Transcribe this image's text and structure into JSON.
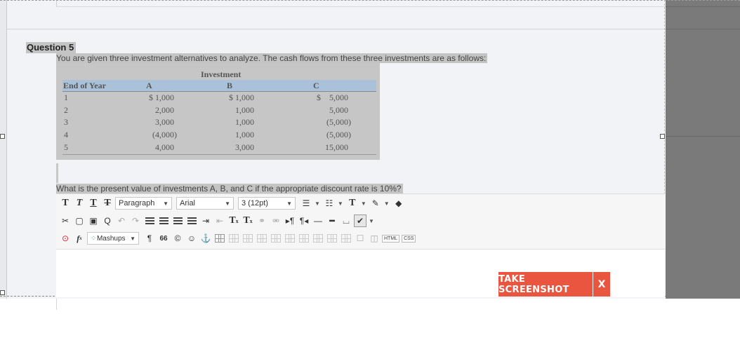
{
  "question": {
    "title": "Question 5",
    "description": "You are given three investment alternatives to analyze. The cash flows from these three investments are as follows:",
    "prompt": "What is the present value of investments A, B, and C if the appropriate discount rate is 10%?"
  },
  "cash_flow_table": {
    "group_header": "Investment",
    "row_header": "End of Year",
    "columns": [
      "A",
      "B",
      "C"
    ],
    "rows": [
      {
        "year": "1",
        "a": "$ 1,000",
        "b": "$ 1,000",
        "c": "$    5,000"
      },
      {
        "year": "2",
        "a": "2,000",
        "b": "1,000",
        "c": "5,000"
      },
      {
        "year": "3",
        "a": "3,000",
        "b": "1,000",
        "c": "(5,000)"
      },
      {
        "year": "4",
        "a": "(4,000)",
        "b": "1,000",
        "c": "(5,000)"
      },
      {
        "year": "5",
        "a": "4,000",
        "b": "3,000",
        "c": "15,000"
      }
    ]
  },
  "toolbar": {
    "format_value": "Paragraph",
    "font_value": "Arial",
    "size_value": "3 (12pt)",
    "mashups_label": "Mashups",
    "html_label": "HTML",
    "css_label": "CSS",
    "fx_label": "f",
    "fx_sub": "x",
    "sup_label": "T",
    "sup_mark": "x",
    "sub_label": "T",
    "sub_mark": "x",
    "quote_glyph": "66"
  },
  "overlay": {
    "take_screenshot_label": "TAKE SCREENSHOT",
    "close_label": "X"
  },
  "colors": {
    "highlight": "#c4c4c4",
    "table_header": "#a9c2da",
    "screenshot_button": "#e9553f",
    "side_overlay": "#7a7a7a"
  }
}
